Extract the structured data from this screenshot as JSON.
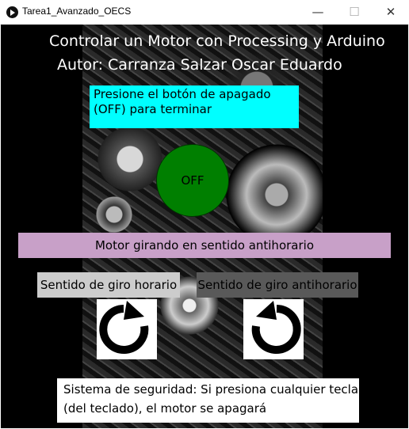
{
  "window": {
    "title": "Tarea1_Avanzado_OECS",
    "minimize_symbol": "—",
    "maximize_symbol": "☐",
    "close_symbol": "✕"
  },
  "header": {
    "line1": "Controlar un Motor con Processing y Arduino",
    "line2": "Autor: Carranza Salzar Oscar Eduardo"
  },
  "instruction": {
    "text": "Presione el botón de apagado (OFF) para terminar"
  },
  "off_button": {
    "label": "OFF",
    "color": "#007f00"
  },
  "status": {
    "text": "Motor girando en sentido antihorario",
    "color": "#c8a0c8"
  },
  "direction_buttons": {
    "clockwise_label": "Sentido de giro horario",
    "counterclockwise_label": "Sentido de giro antihorario"
  },
  "icons": {
    "clockwise": "clockwise-arrow-icon",
    "counterclockwise": "counterclockwise-arrow-icon"
  },
  "footer": {
    "text": "Sistema de seguridad: Si presiona cualquier tecla (del teclado), el motor se apagará"
  }
}
